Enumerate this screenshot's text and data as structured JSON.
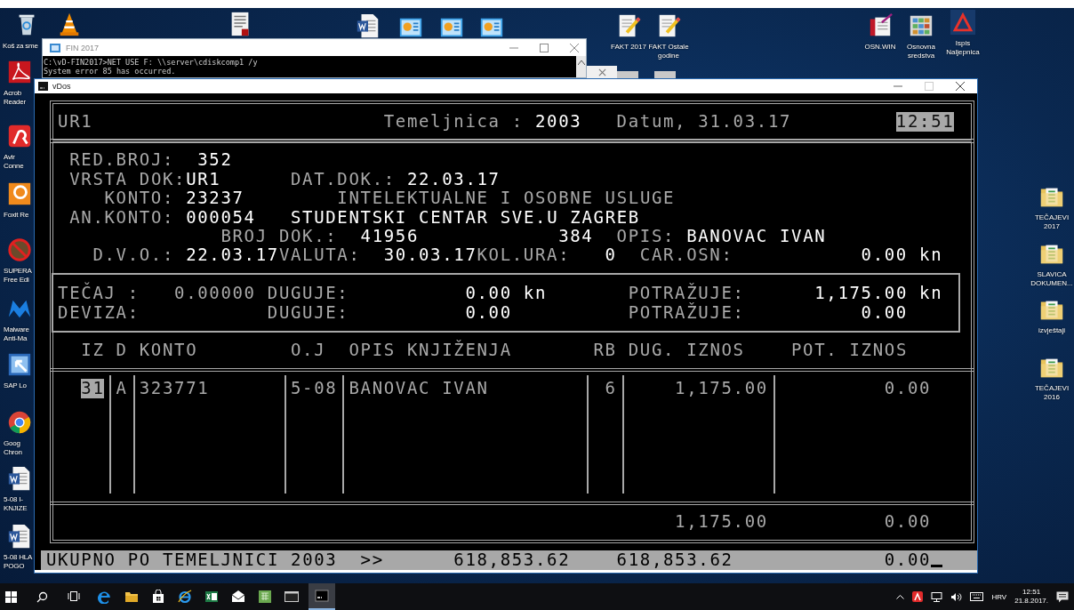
{
  "desktop_icons": [
    {
      "kind": "recycle",
      "label": "Koš za sme"
    },
    {
      "kind": "cone"
    },
    {
      "kind": "pdfdoc"
    },
    {
      "kind": "worddoc"
    },
    {
      "kind": "chart"
    },
    {
      "kind": "chart"
    },
    {
      "kind": "chart"
    },
    {
      "kind": "notepad",
      "label": "FAKT 2017"
    },
    {
      "kind": "notepad",
      "label": "FAKT Ostale\ngodine"
    },
    {
      "kind": "tools",
      "label": "OSN.WIN"
    },
    {
      "kind": "gallery",
      "label": "Osnovna\nsredstva"
    },
    {
      "kind": "triangle",
      "label": "Ispis\nNaljepnica"
    },
    {
      "kind": "acrobat",
      "label": "Acrob\nReader"
    },
    {
      "kind": "avira",
      "label": "Avir\nConne"
    },
    {
      "kind": "foxit",
      "label": "Foxit Re"
    },
    {
      "kind": "blocked",
      "label": "SUPERA\nFree Edi"
    },
    {
      "kind": "malware",
      "label": "Malware\nAnti-Ma"
    },
    {
      "kind": "arrow",
      "label": "SAP Lo"
    },
    {
      "kind": "chrome",
      "label": "Goog\nChron"
    },
    {
      "kind": "worddoc",
      "label": "5-08 I-\nKNJIZE"
    },
    {
      "kind": "worddoc",
      "label": "5-08 HLA\nPOGO"
    },
    {
      "kind": "folder",
      "label": "TEČAJEVI\n2017"
    },
    {
      "kind": "folder",
      "label": "SLAVICA\nDOKUMEN..."
    },
    {
      "kind": "folder",
      "label": "izvještaji"
    },
    {
      "kind": "folder",
      "label": "TEČAJEVI\n2016"
    }
  ],
  "console_window": {
    "title": "FIN 2017",
    "lines": [
      "C:\\vD-FIN2017>NET USE F: \\\\server\\cdiskcomp1 /y",
      "System error 85 has occurred."
    ]
  },
  "dos_window": {
    "title": "vDos"
  },
  "dos": {
    "header": [
      {
        "text": "UR1",
        "kind": "label"
      },
      {
        "text": "Temeljnica :",
        "kind": "label"
      },
      {
        "text": "2003",
        "kind": "value"
      },
      {
        "text": "Datum, 31.03.17",
        "kind": "label"
      },
      {
        "text": "12:51",
        "kind": "highlight"
      }
    ],
    "document": [
      {
        "text": "RED.BROJ:",
        "kind": "label"
      },
      {
        "text": "352",
        "kind": "value"
      },
      {
        "text": "VRSTA DOK:",
        "kind": "label"
      },
      {
        "text": "UR1",
        "kind": "value"
      },
      {
        "text": "DAT.DOK.:",
        "kind": "label"
      },
      {
        "text": "22.03.17",
        "kind": "value"
      },
      {
        "text": "KONTO:",
        "kind": "label"
      },
      {
        "text": "23237",
        "kind": "value"
      },
      {
        "text": "INTELEKTUALNE I OSOBNE USLUGE",
        "kind": "label"
      },
      {
        "text": "AN.KONTO:",
        "kind": "label"
      },
      {
        "text": "000054",
        "kind": "value"
      },
      {
        "text": "STUDENTSKI CENTAR SVE.U ZAGREB",
        "kind": "value"
      },
      {
        "text": "BROJ DOK.:",
        "kind": "label"
      },
      {
        "text": "41956",
        "kind": "value"
      },
      {
        "text": "384",
        "kind": "value"
      },
      {
        "text": "OPIS:",
        "kind": "label"
      },
      {
        "text": "BANOVAC IVAN",
        "kind": "value"
      },
      {
        "text": "D.V.O.:",
        "kind": "label"
      },
      {
        "text": "22.03.17",
        "kind": "value"
      },
      {
        "text": "VALUTA:",
        "kind": "label"
      },
      {
        "text": "30.03.17",
        "kind": "value"
      },
      {
        "text": "KOL.URA:",
        "kind": "label"
      },
      {
        "text": "0",
        "kind": "value"
      },
      {
        "text": "CAR.OSN:",
        "kind": "label"
      },
      {
        "text": "0.00 kn",
        "kind": "value"
      }
    ],
    "amounts": [
      {
        "text": "TEČAJ :",
        "kind": "label"
      },
      {
        "text": "0.00000",
        "kind": "label"
      },
      {
        "text": "DUGUJE:",
        "kind": "label"
      },
      {
        "text": "0.00 kn",
        "kind": "value"
      },
      {
        "text": "POTRAŽUJE:",
        "kind": "label"
      },
      {
        "text": "1,175.00 kn",
        "kind": "value"
      },
      {
        "text": "DEVIZA:",
        "kind": "label"
      },
      {
        "text": "DUGUJE:",
        "kind": "label"
      },
      {
        "text": "0.00",
        "kind": "value"
      },
      {
        "text": "POTRAŽUJE:",
        "kind": "label"
      },
      {
        "text": "0.00",
        "kind": "value"
      }
    ],
    "columns": [
      "IZ",
      "D",
      "KONTO",
      "O.J",
      "OPIS KNJIŽENJA",
      "RB",
      "DUG. IZNOS",
      "POT. IZNOS"
    ],
    "rows": [
      {
        "cells": [
          {
            "text": "31",
            "kind": "highlight"
          },
          {
            "text": "A",
            "kind": "label"
          },
          {
            "text": "323771",
            "kind": "label"
          },
          {
            "text": "5-08",
            "kind": "label"
          },
          {
            "text": "BANOVAC IVAN",
            "kind": "label"
          },
          {
            "text": "6",
            "kind": "label"
          },
          {
            "text": "1,175.00",
            "kind": "label"
          },
          {
            "text": "0.00",
            "kind": "label"
          }
        ]
      }
    ],
    "totals": [
      "1,175.00",
      "0.00"
    ],
    "status_bar": [
      "UKUPNO PO TEMELJNICI 2003",
      ">>",
      "618,853.62",
      "618,853.62",
      "0.00"
    ]
  },
  "taskbar": {
    "apps": [
      {
        "kind": "edge",
        "selected": false
      },
      {
        "kind": "explorer",
        "selected": false
      },
      {
        "kind": "store",
        "selected": false
      },
      {
        "kind": "ie",
        "selected": false
      },
      {
        "kind": "excel",
        "selected": false
      },
      {
        "kind": "mail",
        "selected": false
      },
      {
        "kind": "sheet",
        "selected": false
      },
      {
        "kind": "console",
        "selected": false
      },
      {
        "kind": "dos",
        "selected": true
      }
    ],
    "language": "HRV",
    "time": "12:51",
    "date": "21.8.2017."
  }
}
